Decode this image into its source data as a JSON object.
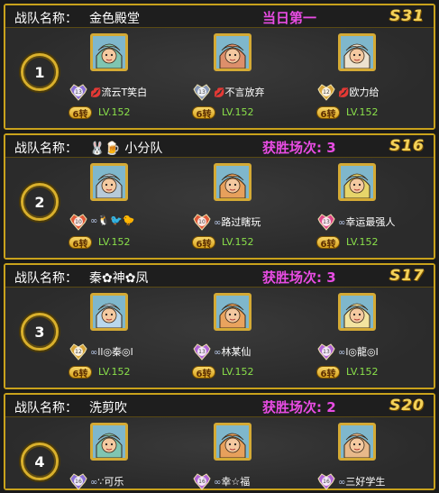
{
  "labels": {
    "team_prefix": "战队名称："
  },
  "teams": [
    {
      "rank": "1",
      "name": "金色殿堂",
      "status": "当日第一",
      "season": "S31",
      "members": [
        {
          "name": "流云T笑白",
          "deco": "lips",
          "badge_level": "13",
          "badge_color": "#8a6fd6",
          "turn": "6转",
          "level": "LV.152",
          "portrait_color": "#7fc5b1"
        },
        {
          "name": "不言放弃",
          "deco": "lips",
          "badge_level": "13",
          "badge_color": "#8898b8",
          "turn": "6转",
          "level": "LV.152",
          "portrait_color": "#dd8f6b"
        },
        {
          "name": "欧力给",
          "deco": "lips",
          "badge_level": "12",
          "badge_color": "#d6a43a",
          "turn": "6转",
          "level": "LV.152",
          "portrait_color": "#ece2cf"
        }
      ]
    },
    {
      "rank": "2",
      "name": "🐰🍺 小分队",
      "status": "获胜场次: 3",
      "season": "S16",
      "members": [
        {
          "name": "🐧🐦🐤",
          "deco": "chain",
          "badge_level": "10",
          "badge_color": "#e05a3a",
          "turn": "6转",
          "level": "LV.152",
          "portrait_color": "#b7cad8"
        },
        {
          "name": "路过瞎玩",
          "deco": "chain",
          "badge_level": "10",
          "badge_color": "#e05a3a",
          "turn": "6转",
          "level": "LV.152",
          "portrait_color": "#e7a05c"
        },
        {
          "name": "幸运最强人",
          "deco": "chain",
          "badge_level": "13",
          "badge_color": "#e04a8a",
          "turn": "6转",
          "level": "LV.152",
          "portrait_color": "#e7d56a"
        }
      ]
    },
    {
      "rank": "3",
      "name": "秦✿神✿凤",
      "status": "获胜场次: 3",
      "season": "S17",
      "members": [
        {
          "name": "ll◎秦◎l",
          "deco": "chain",
          "badge_level": "12",
          "badge_color": "#d6a43a",
          "turn": "6转",
          "level": "LV.152",
          "portrait_color": "#b9d7ec"
        },
        {
          "name": "林某仙",
          "deco": "chain",
          "badge_level": "13",
          "badge_color": "#b266d6",
          "turn": "6转",
          "level": "LV.152",
          "portrait_color": "#e9a35e"
        },
        {
          "name": "l◎龍◎l",
          "deco": "chain",
          "badge_level": "13",
          "badge_color": "#b266d6",
          "turn": "6转",
          "level": "LV.152",
          "portrait_color": "#f3e4a0"
        }
      ]
    },
    {
      "rank": "4",
      "name": "洗剪吹",
      "status": "获胜场次: 2",
      "season": "S20",
      "members": [
        {
          "name": "∵可乐",
          "deco": "chain",
          "badge_level": "16",
          "badge_color": "#8a6fd6",
          "turn": "6转",
          "level": "LV.152",
          "portrait_color": "#7fc5b1"
        },
        {
          "name": "幸☆福",
          "deco": "chain",
          "badge_level": "16",
          "badge_color": "#b266d6",
          "turn": "6转",
          "level": "LV.152",
          "portrait_color": "#e7a05c"
        },
        {
          "name": "三好学生",
          "deco": "chain",
          "badge_level": "16",
          "badge_color": "#b266d6",
          "turn": "6转",
          "level": "LV.152",
          "portrait_color": "#e8b98a"
        }
      ]
    }
  ]
}
